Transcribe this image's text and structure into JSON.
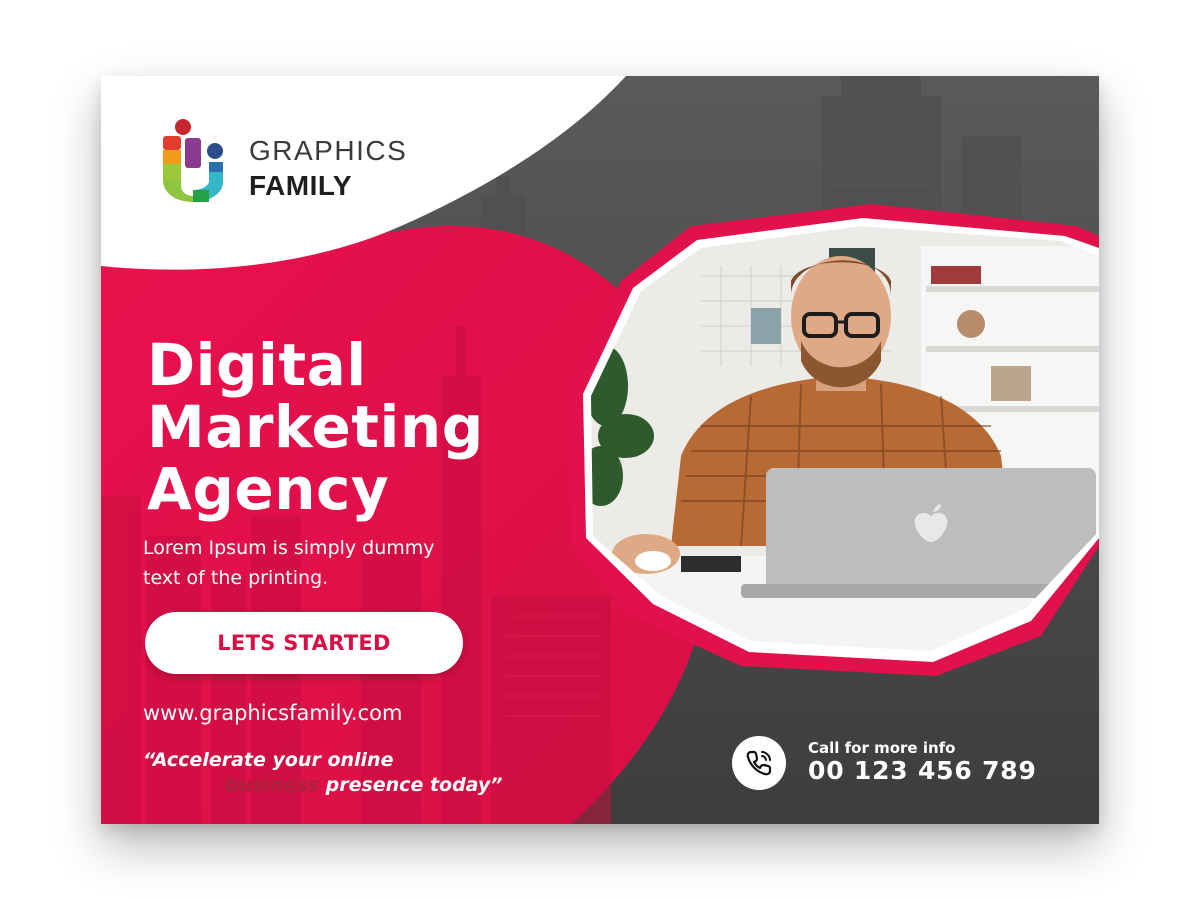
{
  "brand": {
    "name_line1": "GRAPHICS",
    "name_line2": "FAMILY"
  },
  "headline": {
    "line1": "Digital",
    "line2": "Marketing",
    "line3": "Agency"
  },
  "body": {
    "line1": "Lorem Ipsum is simply dummy",
    "line2": "text of the printing."
  },
  "cta": {
    "label": "LETS STARTED"
  },
  "website": "www.graphicsfamily.com",
  "tagline": {
    "part1": "“Accelerate your online",
    "part2_faded": "business",
    "part3": " presence today”"
  },
  "contact": {
    "label": "Call for more info",
    "phone": "00 123 456 789"
  },
  "icons": {
    "logo": "graphics-family-logo-icon",
    "phone": "phone-icon",
    "photo": "man-at-laptop-photo"
  },
  "colors": {
    "accent": "#e0114b",
    "dark": "#444444",
    "white": "#ffffff"
  }
}
